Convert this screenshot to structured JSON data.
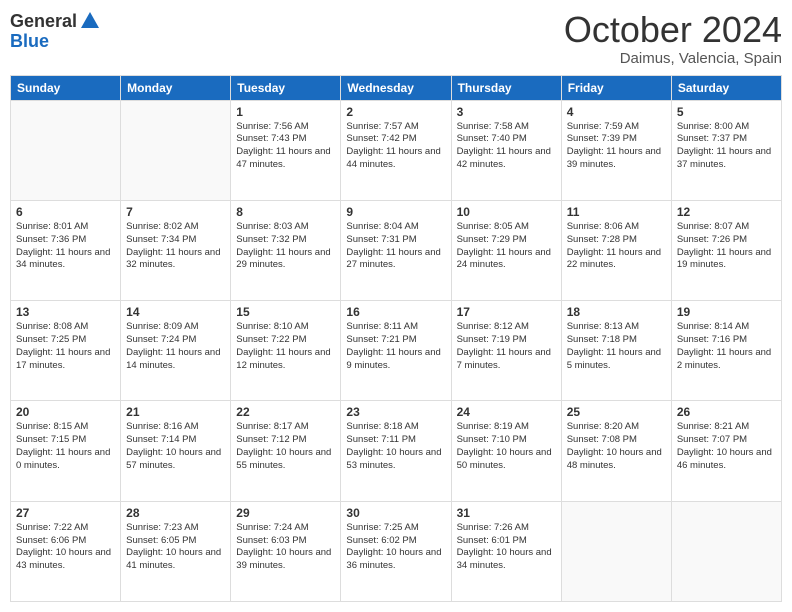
{
  "header": {
    "logo_general": "General",
    "logo_blue": "Blue",
    "month": "October 2024",
    "location": "Daimus, Valencia, Spain"
  },
  "weekdays": [
    "Sunday",
    "Monday",
    "Tuesday",
    "Wednesday",
    "Thursday",
    "Friday",
    "Saturday"
  ],
  "weeks": [
    [
      {
        "day": "",
        "info": ""
      },
      {
        "day": "",
        "info": ""
      },
      {
        "day": "1",
        "info": "Sunrise: 7:56 AM\nSunset: 7:43 PM\nDaylight: 11 hours and 47 minutes."
      },
      {
        "day": "2",
        "info": "Sunrise: 7:57 AM\nSunset: 7:42 PM\nDaylight: 11 hours and 44 minutes."
      },
      {
        "day": "3",
        "info": "Sunrise: 7:58 AM\nSunset: 7:40 PM\nDaylight: 11 hours and 42 minutes."
      },
      {
        "day": "4",
        "info": "Sunrise: 7:59 AM\nSunset: 7:39 PM\nDaylight: 11 hours and 39 minutes."
      },
      {
        "day": "5",
        "info": "Sunrise: 8:00 AM\nSunset: 7:37 PM\nDaylight: 11 hours and 37 minutes."
      }
    ],
    [
      {
        "day": "6",
        "info": "Sunrise: 8:01 AM\nSunset: 7:36 PM\nDaylight: 11 hours and 34 minutes."
      },
      {
        "day": "7",
        "info": "Sunrise: 8:02 AM\nSunset: 7:34 PM\nDaylight: 11 hours and 32 minutes."
      },
      {
        "day": "8",
        "info": "Sunrise: 8:03 AM\nSunset: 7:32 PM\nDaylight: 11 hours and 29 minutes."
      },
      {
        "day": "9",
        "info": "Sunrise: 8:04 AM\nSunset: 7:31 PM\nDaylight: 11 hours and 27 minutes."
      },
      {
        "day": "10",
        "info": "Sunrise: 8:05 AM\nSunset: 7:29 PM\nDaylight: 11 hours and 24 minutes."
      },
      {
        "day": "11",
        "info": "Sunrise: 8:06 AM\nSunset: 7:28 PM\nDaylight: 11 hours and 22 minutes."
      },
      {
        "day": "12",
        "info": "Sunrise: 8:07 AM\nSunset: 7:26 PM\nDaylight: 11 hours and 19 minutes."
      }
    ],
    [
      {
        "day": "13",
        "info": "Sunrise: 8:08 AM\nSunset: 7:25 PM\nDaylight: 11 hours and 17 minutes."
      },
      {
        "day": "14",
        "info": "Sunrise: 8:09 AM\nSunset: 7:24 PM\nDaylight: 11 hours and 14 minutes."
      },
      {
        "day": "15",
        "info": "Sunrise: 8:10 AM\nSunset: 7:22 PM\nDaylight: 11 hours and 12 minutes."
      },
      {
        "day": "16",
        "info": "Sunrise: 8:11 AM\nSunset: 7:21 PM\nDaylight: 11 hours and 9 minutes."
      },
      {
        "day": "17",
        "info": "Sunrise: 8:12 AM\nSunset: 7:19 PM\nDaylight: 11 hours and 7 minutes."
      },
      {
        "day": "18",
        "info": "Sunrise: 8:13 AM\nSunset: 7:18 PM\nDaylight: 11 hours and 5 minutes."
      },
      {
        "day": "19",
        "info": "Sunrise: 8:14 AM\nSunset: 7:16 PM\nDaylight: 11 hours and 2 minutes."
      }
    ],
    [
      {
        "day": "20",
        "info": "Sunrise: 8:15 AM\nSunset: 7:15 PM\nDaylight: 11 hours and 0 minutes."
      },
      {
        "day": "21",
        "info": "Sunrise: 8:16 AM\nSunset: 7:14 PM\nDaylight: 10 hours and 57 minutes."
      },
      {
        "day": "22",
        "info": "Sunrise: 8:17 AM\nSunset: 7:12 PM\nDaylight: 10 hours and 55 minutes."
      },
      {
        "day": "23",
        "info": "Sunrise: 8:18 AM\nSunset: 7:11 PM\nDaylight: 10 hours and 53 minutes."
      },
      {
        "day": "24",
        "info": "Sunrise: 8:19 AM\nSunset: 7:10 PM\nDaylight: 10 hours and 50 minutes."
      },
      {
        "day": "25",
        "info": "Sunrise: 8:20 AM\nSunset: 7:08 PM\nDaylight: 10 hours and 48 minutes."
      },
      {
        "day": "26",
        "info": "Sunrise: 8:21 AM\nSunset: 7:07 PM\nDaylight: 10 hours and 46 minutes."
      }
    ],
    [
      {
        "day": "27",
        "info": "Sunrise: 7:22 AM\nSunset: 6:06 PM\nDaylight: 10 hours and 43 minutes."
      },
      {
        "day": "28",
        "info": "Sunrise: 7:23 AM\nSunset: 6:05 PM\nDaylight: 10 hours and 41 minutes."
      },
      {
        "day": "29",
        "info": "Sunrise: 7:24 AM\nSunset: 6:03 PM\nDaylight: 10 hours and 39 minutes."
      },
      {
        "day": "30",
        "info": "Sunrise: 7:25 AM\nSunset: 6:02 PM\nDaylight: 10 hours and 36 minutes."
      },
      {
        "day": "31",
        "info": "Sunrise: 7:26 AM\nSunset: 6:01 PM\nDaylight: 10 hours and 34 minutes."
      },
      {
        "day": "",
        "info": ""
      },
      {
        "day": "",
        "info": ""
      }
    ]
  ]
}
